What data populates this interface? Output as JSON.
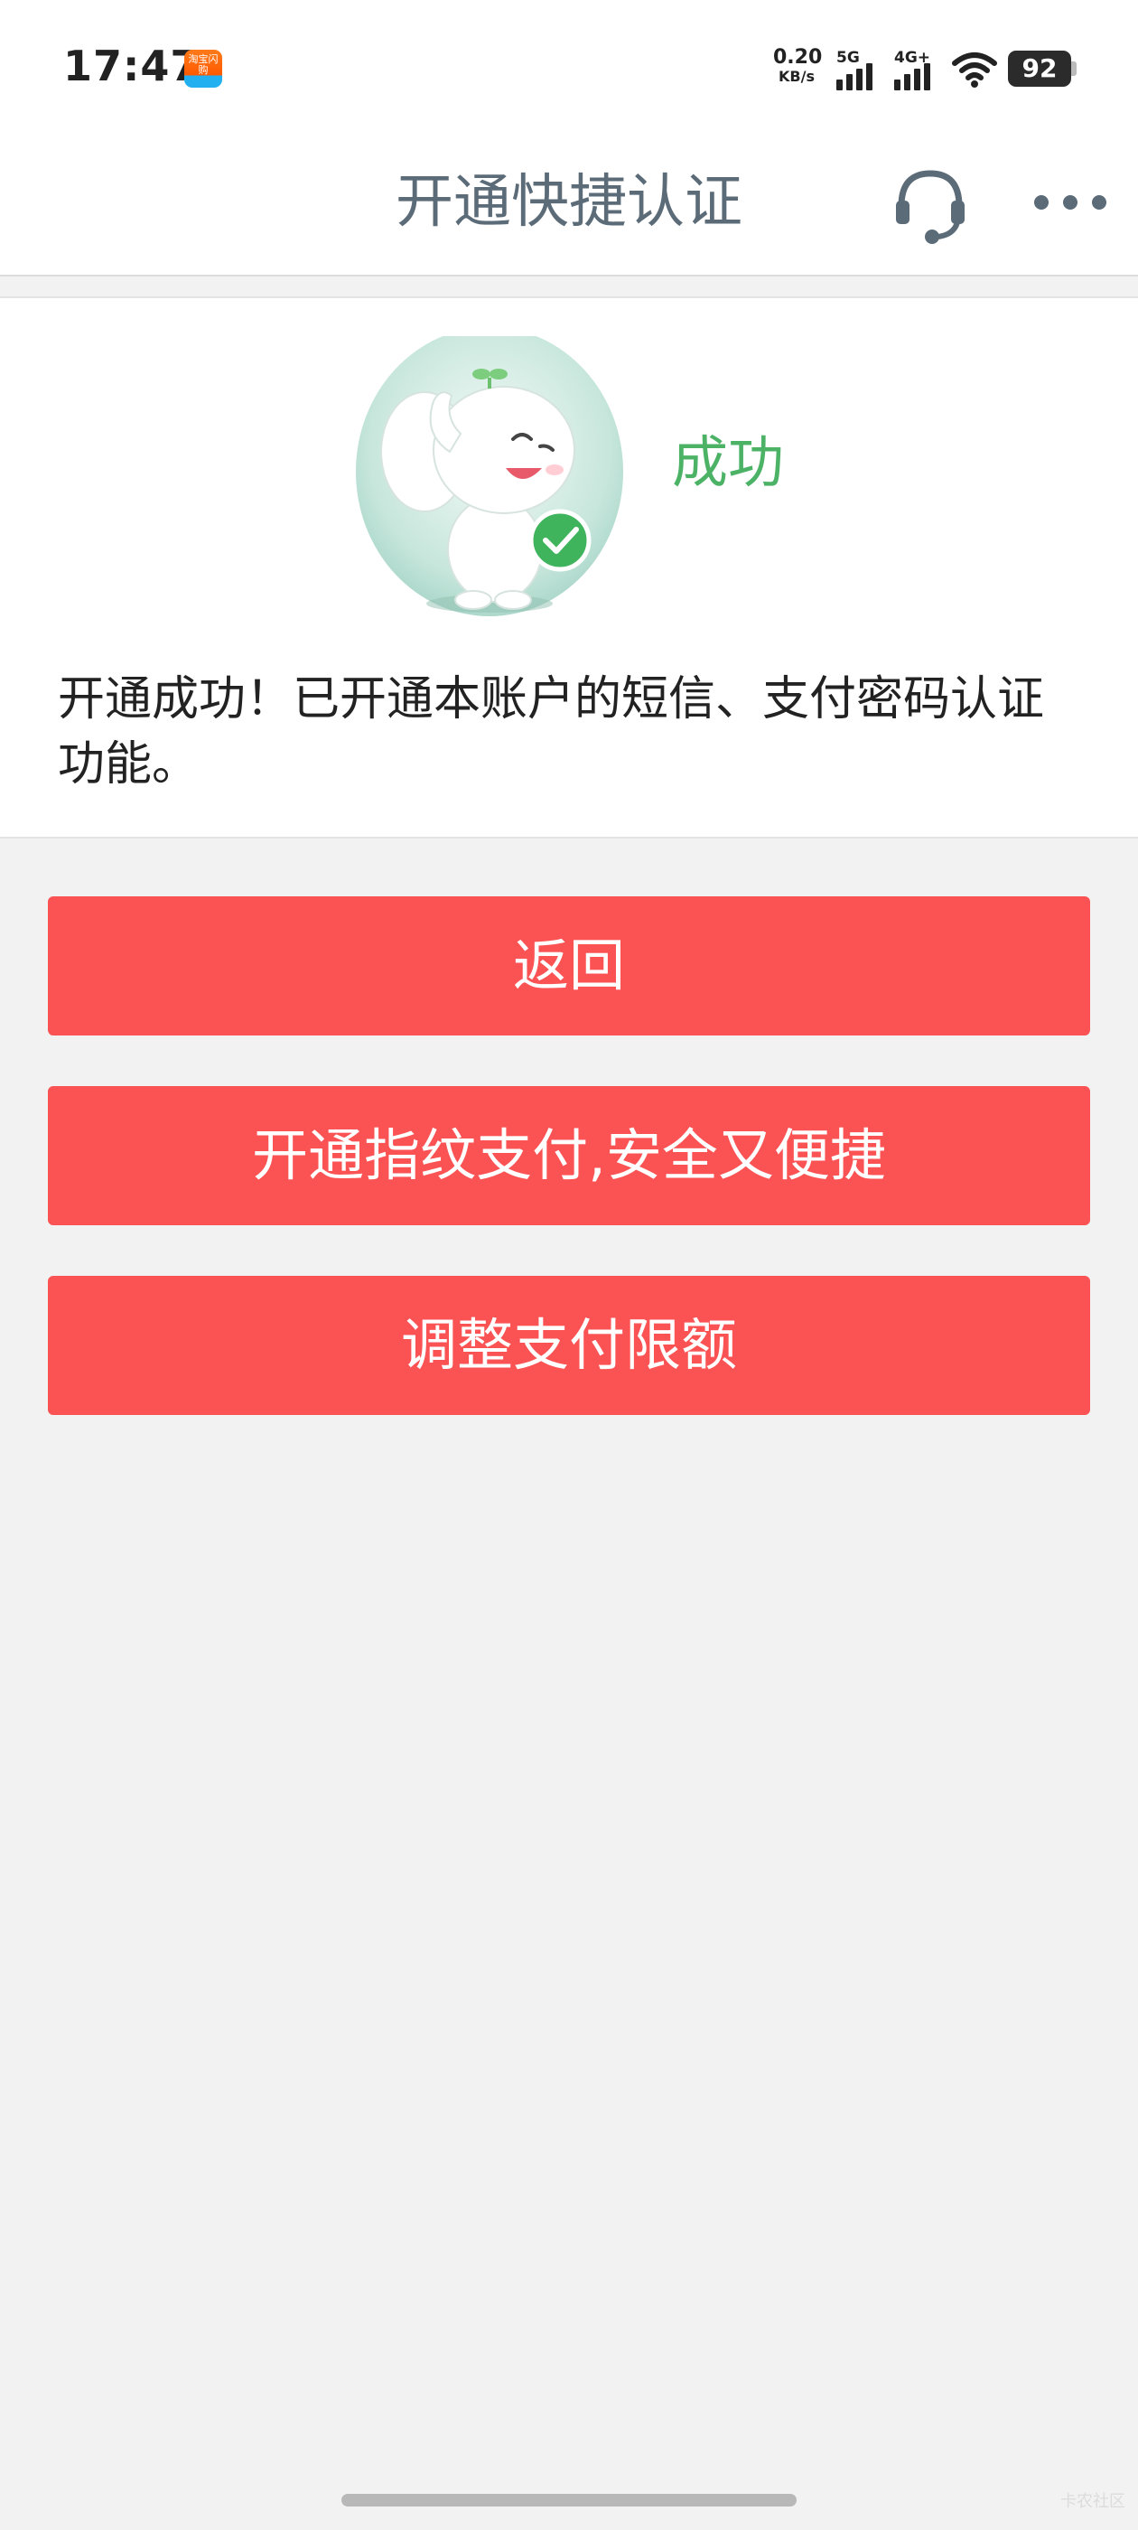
{
  "status_bar": {
    "time": "17:47",
    "app_badge": "淘宝闪购",
    "net_speed_value": "0.20",
    "net_speed_unit": "KB/s",
    "signal_1_label": "5G",
    "signal_2_label": "4G+",
    "battery_level": "92"
  },
  "nav": {
    "title": "开通快捷认证",
    "headset_icon": "headset-icon",
    "more_icon": "more-horizontal-icon"
  },
  "result": {
    "status_label": "成功",
    "message": "开通成功！已开通本账户的短信、支付密码认证功能。",
    "status_color": "#4cb366",
    "mascot_icon": "elephant-mascot-icon",
    "check_icon": "check-circle-icon"
  },
  "actions": {
    "back_label": "返回",
    "fingerprint_label": "开通指纹支付,安全又便捷",
    "limit_label": "调整支付限额",
    "button_color": "#fb5254"
  },
  "footer": {
    "watermark": "卡农社区"
  }
}
